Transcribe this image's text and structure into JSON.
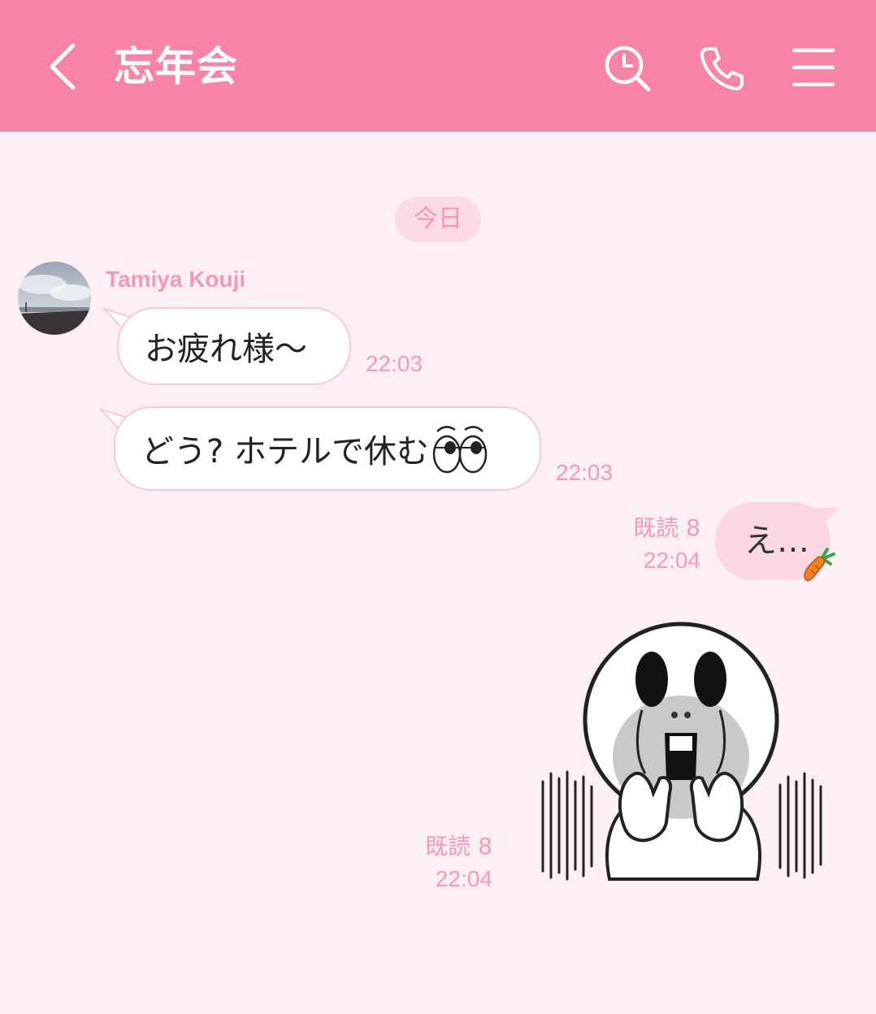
{
  "header": {
    "title": "忘年会",
    "back_icon": "chevron-left-icon",
    "search_icon": "search-icon",
    "call_icon": "phone-icon",
    "menu_icon": "menu-icon",
    "background_color": "#f784a7"
  },
  "chat": {
    "date_label": "今日",
    "sender_name": "Tamiya Kouji",
    "messages": [
      {
        "from": "Tamiya Kouji",
        "text": "お疲れ様〜",
        "time": "22:03"
      },
      {
        "from": "Tamiya Kouji",
        "text": "どう? ホテルで休む",
        "emoji_icon": "rolling-eyes-emoji-icon",
        "time": "22:03"
      },
      {
        "from": "me",
        "text": "え…",
        "emoji_icon": "carrot-icon",
        "read": "既読 8",
        "time": "22:04"
      },
      {
        "from": "me",
        "sticker": "shocked-face-sticker",
        "read": "既読 8",
        "time": "22:04"
      }
    ]
  },
  "colors": {
    "accent": "#f784a7",
    "chat_background": "#fdf0f4",
    "meta_text": "#f598b6",
    "my_bubble": "#fbd7e4"
  }
}
